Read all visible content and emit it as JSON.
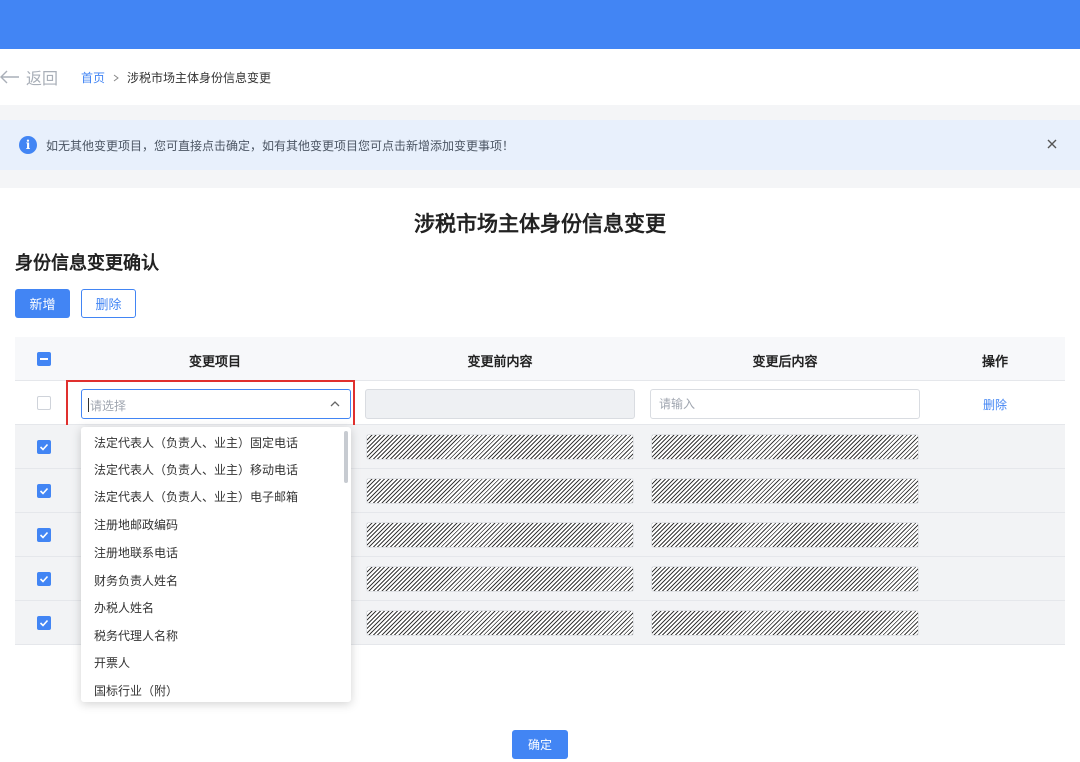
{
  "nav": {
    "back_label": "返回",
    "breadcrumb": {
      "home": "首页",
      "current": "涉税市场主体身份信息变更"
    }
  },
  "alert": {
    "icon": "info-icon",
    "text": "如无其他变更项目，您可直接点击确定，如有其他变更项目您可点击新增添加变更事项！",
    "close_icon": "close-icon"
  },
  "page": {
    "title": "涉税市场主体身份信息变更",
    "section_title": "身份信息变更确认",
    "add_label": "新增",
    "delete_label": "删除",
    "confirm_label": "确定"
  },
  "table": {
    "headers": {
      "item": "变更项目",
      "before": "变更前内容",
      "after": "变更后内容",
      "operation": "操作"
    },
    "new_row": {
      "select_placeholder": "请选择",
      "input_placeholder": "请输入",
      "delete_label": "删除"
    },
    "checked_rows": 5
  },
  "dropdown": {
    "options": [
      "法定代表人（负责人、业主）固定电话",
      "法定代表人（负责人、业主）移动电话",
      "法定代表人（负责人、业主）电子邮箱",
      "注册地邮政编码",
      "注册地联系电话",
      "财务负责人姓名",
      "办税人姓名",
      "税务代理人名称",
      "开票人",
      "国标行业（附）"
    ]
  },
  "colors": {
    "primary": "#4285f4",
    "alert_bg": "#e8f0fc",
    "highlight": "#e0302e"
  }
}
